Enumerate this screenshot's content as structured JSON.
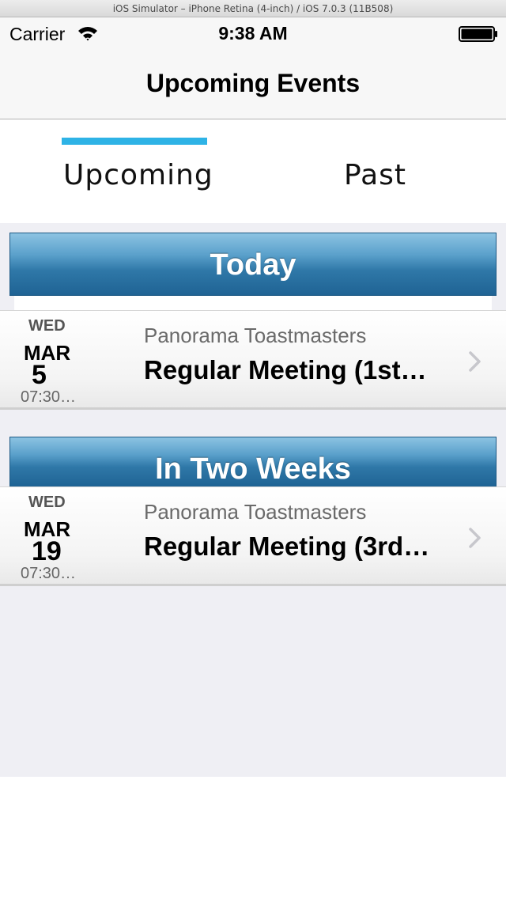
{
  "simulator": {
    "title": "iOS Simulator – iPhone Retina (4-inch) / iOS 7.0.3 (11B508)"
  },
  "status_bar": {
    "carrier": "Carrier",
    "time": "9:38 AM"
  },
  "nav": {
    "title": "Upcoming Events"
  },
  "tabs": [
    {
      "label": "Upcoming",
      "selected": true
    },
    {
      "label": "Past",
      "selected": false
    }
  ],
  "accent_color": "#2eb3e6",
  "sections": [
    {
      "header": "Today",
      "events": [
        {
          "dow": "WED",
          "month": "MAR",
          "day": "5",
          "time": "07:30…",
          "org": "Panorama Toastmasters",
          "title": "Regular Meeting (1st…"
        }
      ]
    },
    {
      "header": "In Two Weeks",
      "events": [
        {
          "dow": "WED",
          "month": "MAR",
          "day": "19",
          "time": "07:30…",
          "org": "Panorama Toastmasters",
          "title": "Regular Meeting (3rd…"
        }
      ]
    }
  ],
  "icons": [
    "wifi-icon",
    "battery-icon",
    "chevron-right-icon"
  ]
}
